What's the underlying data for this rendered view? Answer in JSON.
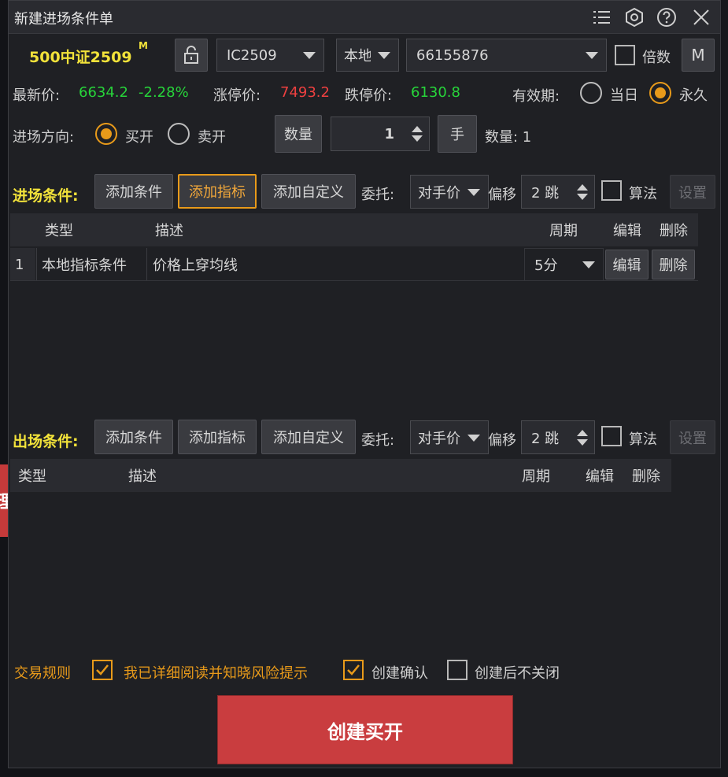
{
  "window": {
    "title": "新建进场条件单"
  },
  "contract": {
    "name": "500中证2509",
    "superscript": "M",
    "code": "IC2509",
    "source": "本地",
    "account": "66155876",
    "multiplier_label": "倍数",
    "m_label": "M"
  },
  "quote": {
    "last_label": "最新价:",
    "last_value": "6634.2",
    "change": "-2.28%",
    "limit_up_label": "涨停价:",
    "limit_up_value": "7493.2",
    "limit_down_label": "跌停价:",
    "limit_down_value": "6130.8",
    "validity_label": "有效期:",
    "validity_today": "当日",
    "validity_forever": "永久"
  },
  "order": {
    "direction_label": "进场方向:",
    "buy_open": "买开",
    "sell_open": "卖开",
    "qty_button": "数量",
    "qty_value": "1",
    "unit_button": "手",
    "qty_summary": "数量: 1"
  },
  "entry": {
    "label": "进场条件:",
    "add_condition": "添加条件",
    "add_indicator": "添加指标",
    "add_custom": "添加自定义",
    "order_label": "委托:",
    "order_value": "对手价",
    "offset_label": "偏移",
    "offset_value": "2 跳",
    "algo_label": "算法",
    "settings": "设置",
    "columns": [
      "类型",
      "描述",
      "周期",
      "编辑",
      "删除"
    ],
    "rows": [
      {
        "index": "1",
        "type": "本地指标条件",
        "desc": "价格上穿均线",
        "period": "5分",
        "edit": "编辑",
        "delete": "删除"
      }
    ]
  },
  "exit": {
    "label": "出场条件:",
    "add_condition": "添加条件",
    "add_indicator": "添加指标",
    "add_custom": "添加自定义",
    "order_label": "委托:",
    "order_value": "对手价",
    "offset_label": "偏移",
    "offset_value": "2 跳",
    "algo_label": "算法",
    "settings": "设置",
    "columns": [
      "类型",
      "描述",
      "周期",
      "编辑",
      "删除"
    ]
  },
  "footer": {
    "rules_label": "交易规则",
    "risk_ack": "我已详细阅读并知晓风险提示",
    "create_confirm": "创建确认",
    "keep_open": "创建后不关闭",
    "create_button": "创建买开"
  },
  "background": {
    "left_glyph": "理"
  },
  "colors": {
    "accent": "#e89a1a",
    "up": "#ee4040",
    "down": "#27d43a",
    "create": "#c93d3f"
  }
}
